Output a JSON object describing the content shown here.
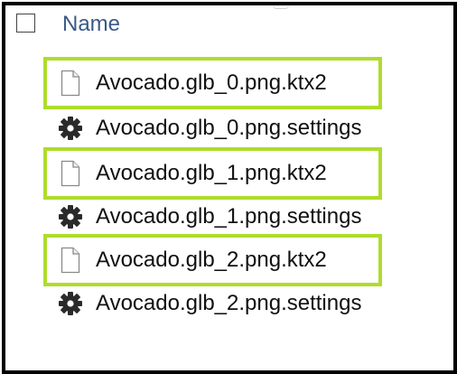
{
  "header": {
    "select_all_checked": false,
    "column_name": "Name"
  },
  "files": [
    {
      "name": "Avocado.glb_0.png.ktx2",
      "icon": "document-icon",
      "highlighted": true
    },
    {
      "name": "Avocado.glb_0.png.settings",
      "icon": "gear-icon",
      "highlighted": false
    },
    {
      "name": "Avocado.glb_1.png.ktx2",
      "icon": "document-icon",
      "highlighted": true
    },
    {
      "name": "Avocado.glb_1.png.settings",
      "icon": "gear-icon",
      "highlighted": false
    },
    {
      "name": "Avocado.glb_2.png.ktx2",
      "icon": "document-icon",
      "highlighted": true
    },
    {
      "name": "Avocado.glb_2.png.settings",
      "icon": "gear-icon",
      "highlighted": false
    }
  ],
  "colors": {
    "highlight": "#aedc2c",
    "column_header": "#3b5a86",
    "frame": "#000000"
  }
}
